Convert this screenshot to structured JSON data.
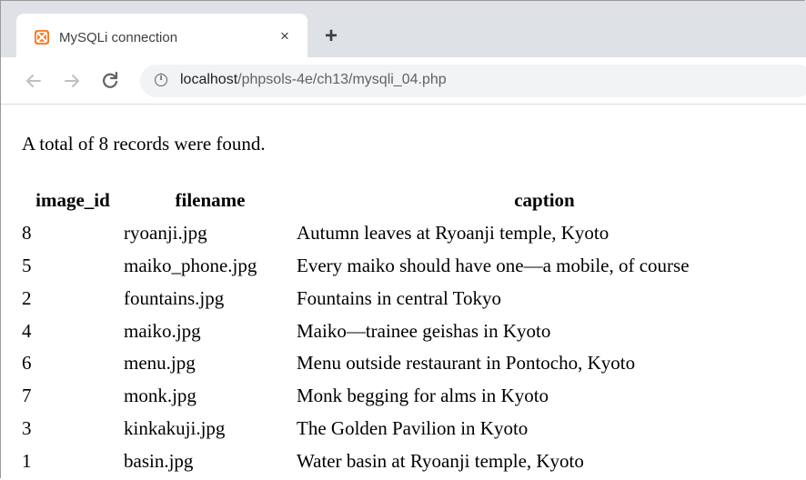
{
  "browser": {
    "tab": {
      "title": "MySQLi connection",
      "close_glyph": "×",
      "favicon": "xampp-icon"
    },
    "new_tab_glyph": "+",
    "nav": {
      "back": "arrow-left-icon",
      "forward": "arrow-right-icon",
      "reload": "reload-icon"
    },
    "address": {
      "host": "localhost",
      "path": "/phpsols-4e/ch13/mysqli_04.php"
    },
    "colors": {
      "tabstrip": "#dee1e6",
      "omnibox": "#f1f3f4",
      "favicon": "#fb7a24"
    }
  },
  "page": {
    "summary": "A total of 8 records were found.",
    "table": {
      "headers": [
        "image_id",
        "filename",
        "caption"
      ],
      "rows": [
        [
          "8",
          "ryoanji.jpg",
          "Autumn leaves at Ryoanji temple, Kyoto"
        ],
        [
          "5",
          "maiko_phone.jpg",
          "Every maiko should have one—a mobile, of course"
        ],
        [
          "2",
          "fountains.jpg",
          "Fountains in central Tokyo"
        ],
        [
          "4",
          "maiko.jpg",
          "Maiko—trainee geishas in Kyoto"
        ],
        [
          "6",
          "menu.jpg",
          "Menu outside restaurant in Pontocho, Kyoto"
        ],
        [
          "7",
          "monk.jpg",
          "Monk begging for alms in Kyoto"
        ],
        [
          "3",
          "kinkakuji.jpg",
          "The Golden Pavilion in Kyoto"
        ],
        [
          "1",
          "basin.jpg",
          "Water basin at Ryoanji temple, Kyoto"
        ]
      ]
    }
  }
}
